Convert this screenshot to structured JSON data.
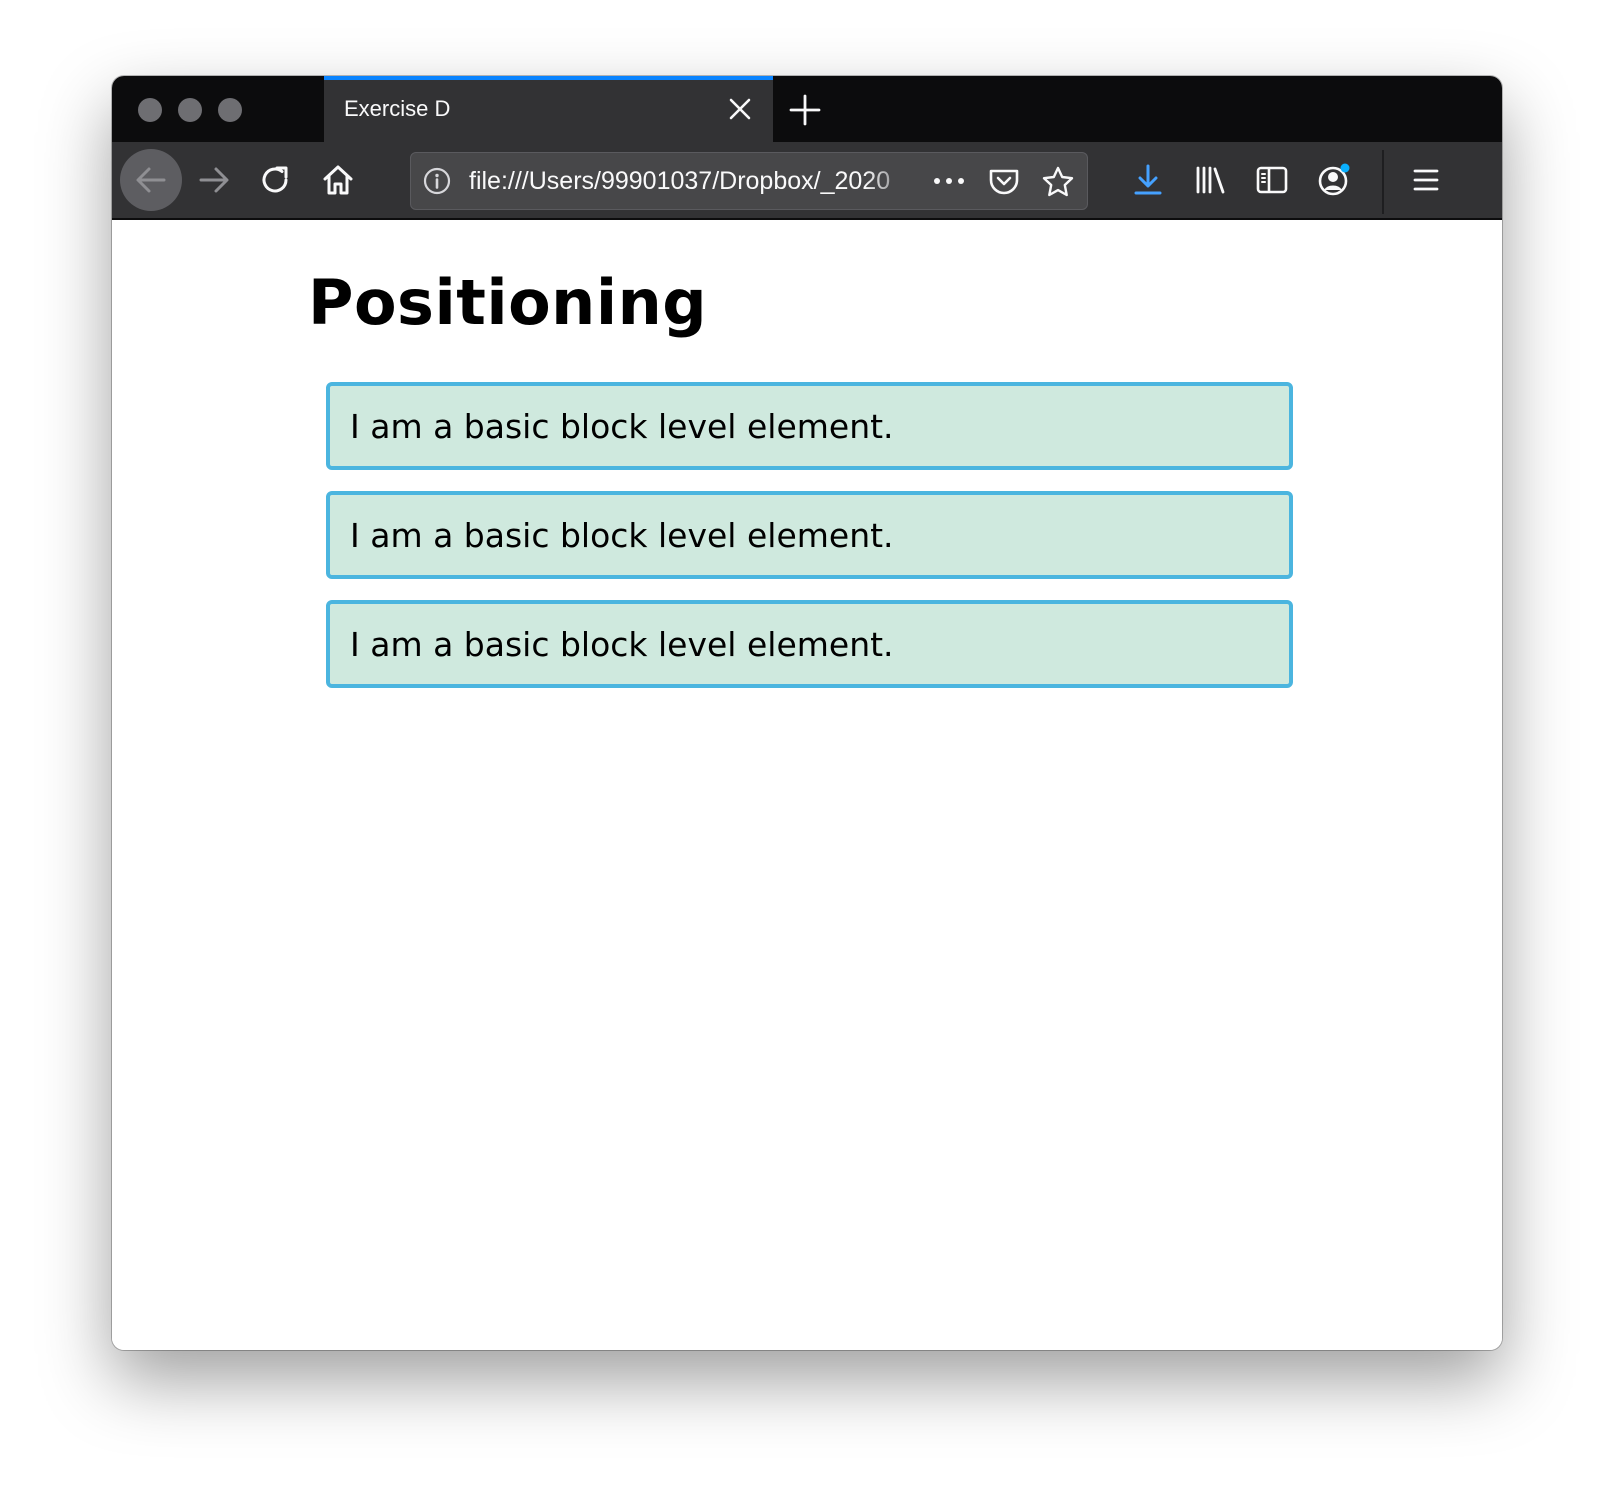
{
  "browser": {
    "tab": {
      "title": "Exercise D"
    },
    "urlbar": {
      "url": "file:///Users/99901037/Dropbox/_2020",
      "more_glyph": "•••"
    },
    "icons": {
      "back": "back-arrow-icon",
      "forward": "forward-arrow-icon",
      "reload": "reload-icon",
      "home": "home-icon",
      "info": "info-icon",
      "pocket": "pocket-icon",
      "star": "star-icon",
      "download": "download-icon",
      "library": "library-icon",
      "sidebar": "sidebar-icon",
      "account": "account-icon",
      "menu": "hamburger-menu-icon"
    },
    "colors": {
      "accent": "#0a84ff",
      "download_accent": "#45a1ff",
      "notification_dot": "#0ab0ff"
    }
  },
  "page": {
    "heading": "Positioning",
    "blocks": [
      {
        "text": "I am a basic block level element."
      },
      {
        "text": "I am a basic block level element."
      },
      {
        "text": "I am a basic block level element."
      }
    ],
    "colors": {
      "block_background": "#cfe9de",
      "block_border": "#4bb5df"
    }
  }
}
